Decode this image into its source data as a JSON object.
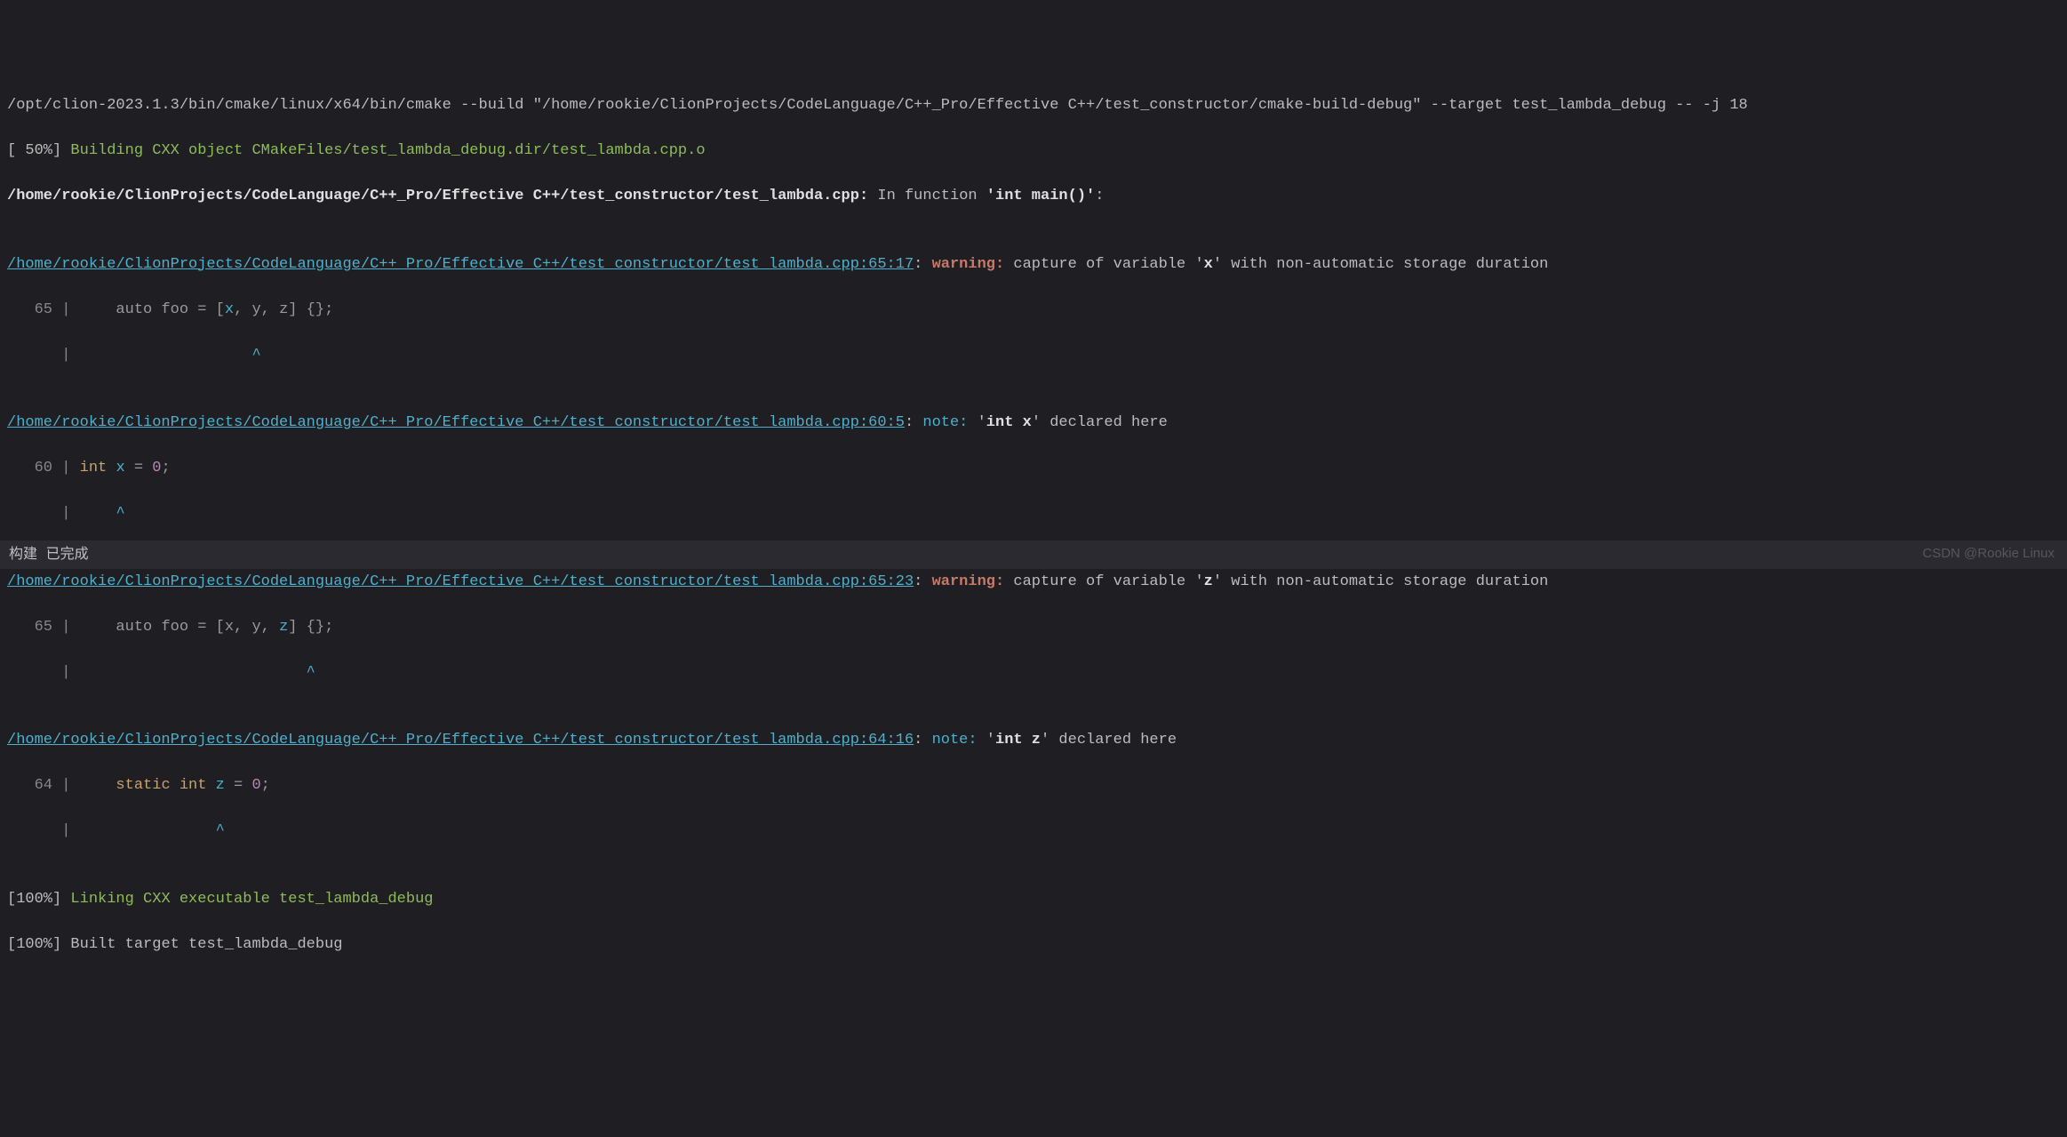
{
  "cmd_line": "/opt/clion-2023.1.3/bin/cmake/linux/x64/bin/cmake --build \"/home/rookie/ClionProjects/CodeLanguage/C++_Pro/Effective C++/test_constructor/cmake-build-debug\" --target test_lambda_debug -- -j 18",
  "build": {
    "pct50": "[ 50%] ",
    "building": "Building CXX object CMakeFiles/test_lambda_debug.dir/test_lambda.cpp.o",
    "pct100a": "[100%] ",
    "linking": "Linking CXX executable test_lambda_debug",
    "pct100b": "[100%] ",
    "built": "Built target test_lambda_debug"
  },
  "msgs": {
    "infunc_prefix": "/home/rookie/ClionProjects/CodeLanguage/C++_Pro/Effective C++/test_constructor/test_lambda.cpp:",
    "infunc_text": " In function ",
    "infunc_sig": "'int main()'",
    "infunc_colon": ":",
    "w1": {
      "link": "/home/rookie/ClionProjects/CodeLanguage/C++_Pro/Effective C++/test_constructor/test_lambda.cpp:65:17",
      "colon1": ": ",
      "tag": "warning: ",
      "text1": "capture of variable '",
      "var": "x",
      "text2": "' with non-automatic storage duration",
      "code_lineno": "   65 | ",
      "code_pre": "    auto foo = [",
      "code_var": "x",
      "code_post": ", y, z] {};",
      "caret_prefix": "      | ",
      "caret_spaces": "                   ",
      "caret": "^"
    },
    "n1": {
      "link": "/home/rookie/ClionProjects/CodeLanguage/C++_Pro/Effective C++/test_constructor/test_lambda.cpp:60:5",
      "colon1": ": ",
      "tag": "note: ",
      "text1": "'",
      "var": "int x",
      "text2": "' declared here",
      "code_lineno": "   60 | ",
      "code_pre": "int ",
      "code_var": "x",
      "code_post": " = ",
      "code_lit": "0",
      "code_semi": ";",
      "caret_prefix": "      | ",
      "caret_spaces": "    ",
      "caret": "^"
    },
    "w2": {
      "link": "/home/rookie/ClionProjects/CodeLanguage/C++_Pro/Effective C++/test_constructor/test_lambda.cpp:65:23",
      "colon1": ": ",
      "tag": "warning: ",
      "text1": "capture of variable '",
      "var": "z",
      "text2": "' with non-automatic storage duration",
      "code_lineno": "   65 | ",
      "code_pre": "    auto foo = [x, y, ",
      "code_var": "z",
      "code_post": "] {};",
      "caret_prefix": "      | ",
      "caret_spaces": "                         ",
      "caret": "^"
    },
    "n2": {
      "link": "/home/rookie/ClionProjects/CodeLanguage/C++_Pro/Effective C++/test_constructor/test_lambda.cpp:64:16",
      "colon1": ": ",
      "tag": "note: ",
      "text1": "'",
      "var": "int z",
      "text2": "' declared here",
      "code_lineno": "   64 | ",
      "code_pre": "    static int ",
      "code_var": "z",
      "code_post": " = ",
      "code_lit": "0",
      "code_semi": ";",
      "caret_prefix": "      | ",
      "caret_spaces": "               ",
      "caret": "^"
    }
  },
  "status": "构建 已完成",
  "watermark": "CSDN @Rookie Linux"
}
